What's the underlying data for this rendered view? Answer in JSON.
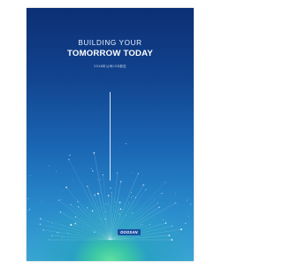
{
  "cover": {
    "title_line1": "BUILDING YOUR",
    "title_line2": "TOMORROW TODAY",
    "subtitle": "2018年公司CSR报告",
    "logo_text": "DOOSAN",
    "background_top_color": "#0c2f74",
    "background_bottom_color": "#3aa6d4",
    "glow_color": "#62e0a0"
  }
}
